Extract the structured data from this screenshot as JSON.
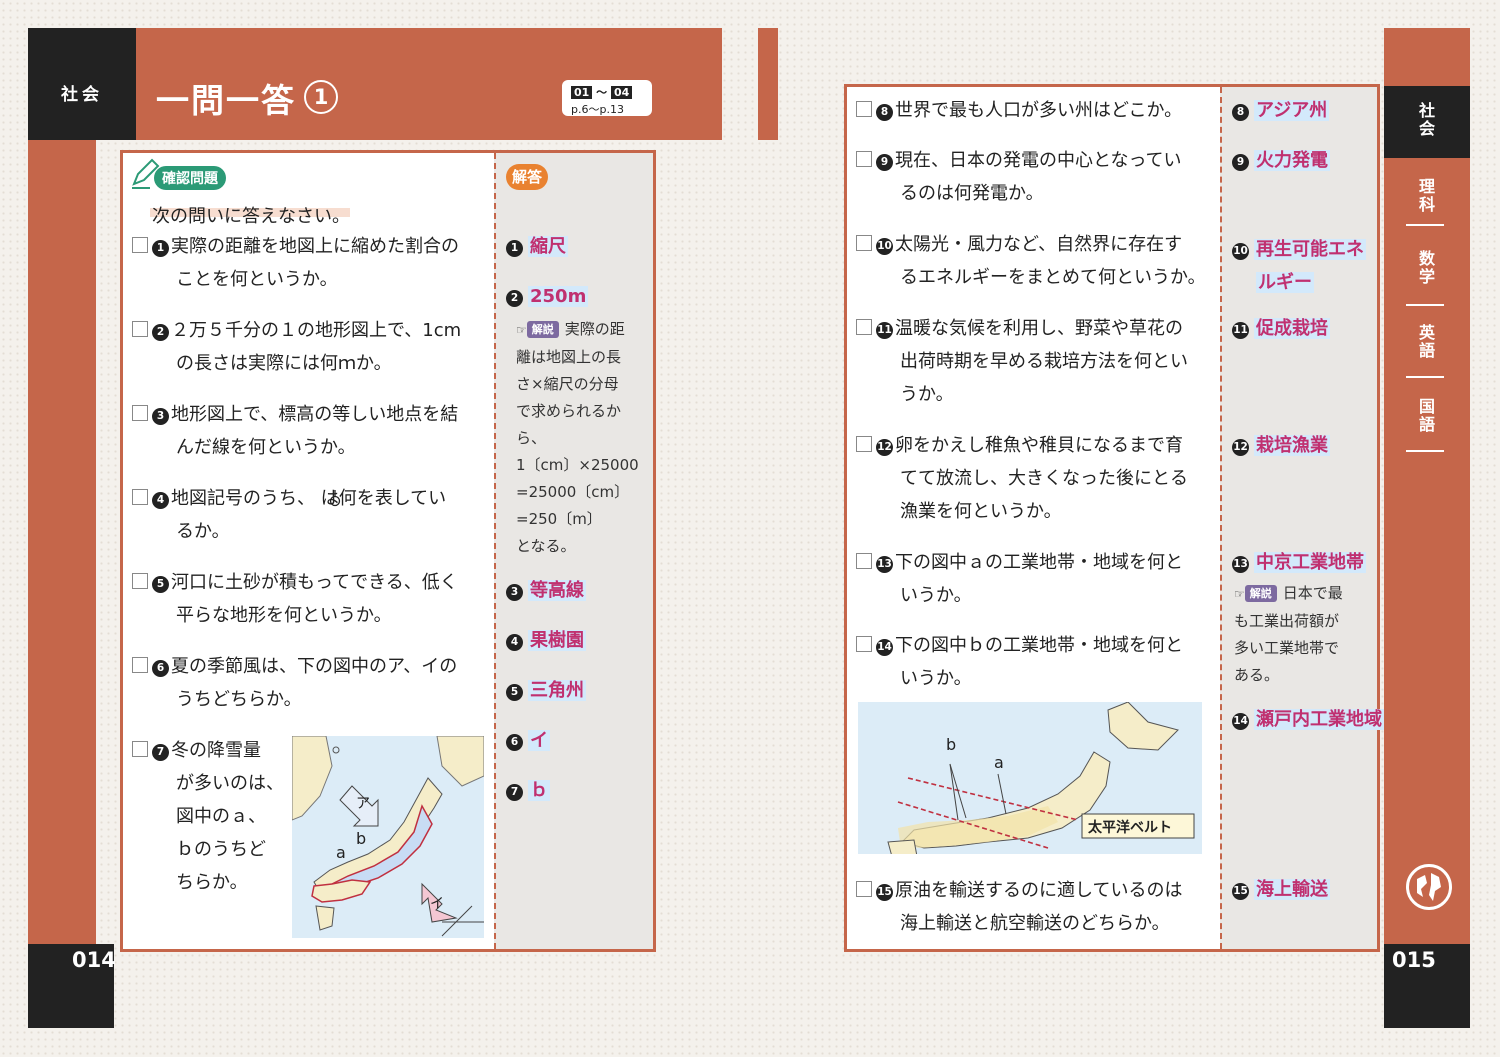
{
  "left_page": {
    "subject": "社会",
    "title": "一問一答",
    "title_number": "1",
    "range": {
      "from": "01",
      "sep": "～",
      "to": "04",
      "pages": "p.6～p.13"
    },
    "page_number": "014",
    "section_badge": "確認問題",
    "answer_badge": "解答",
    "instruction": "次の問いに答えなさい。",
    "questions": [
      {
        "n": "1",
        "lines": [
          "実際の距離を地図上に縮めた割合の",
          "ことを何というか。"
        ]
      },
      {
        "n": "2",
        "lines": [
          "２万５千分の１の地形図上で、1cm",
          "の長さは実際には何ｍか。"
        ]
      },
      {
        "n": "3",
        "lines": [
          "地形図上で、標高の等しい地点を結",
          "んだ線を何というか。"
        ]
      },
      {
        "n": "4",
        "lines": [
          "地図記号のうち、 は何を表してい",
          "るか。"
        ]
      },
      {
        "n": "5",
        "lines": [
          "河口に土砂が積もってできる、低く",
          "平らな地形を何というか。"
        ]
      },
      {
        "n": "6",
        "lines": [
          "夏の季節風は、下の図中のア、イの",
          "うちどちらか。"
        ]
      },
      {
        "n": "7",
        "lines": [
          "冬の降雪量",
          "が多いのは、",
          "図中のａ、",
          "ｂのうちど",
          "ちらか。"
        ]
      }
    ],
    "answers": [
      {
        "n": "1",
        "text": "縮尺"
      },
      {
        "n": "2",
        "text": "250m"
      },
      {
        "n": "3",
        "text": "等高線"
      },
      {
        "n": "4",
        "text": "果樹園"
      },
      {
        "n": "5",
        "text": "三角州"
      },
      {
        "n": "6",
        "text": "イ"
      },
      {
        "n": "7",
        "text": "ｂ"
      }
    ],
    "explanation": {
      "tag": "解説",
      "lines": [
        "実際の距",
        "離は地図上の長",
        "さ×縮尺の分母",
        "で求められるか",
        "ら、",
        "1〔cm〕×25000",
        "=25000〔cm〕",
        "=250〔m〕",
        "となる。"
      ]
    },
    "map_labels": {
      "a": "a",
      "b": "b",
      "ア": "ア",
      "イ": "イ"
    }
  },
  "right_page": {
    "page_number": "015",
    "side_tabs": [
      "社会",
      "理科",
      "数学",
      "英語",
      "国語"
    ],
    "questions": [
      {
        "n": "8",
        "lines": [
          "世界で最も人口が多い州はどこか。"
        ]
      },
      {
        "n": "9",
        "lines": [
          "現在、日本の発電の中心となってい",
          "るのは何発電か。"
        ]
      },
      {
        "n": "10",
        "lines": [
          "太陽光・風力など、自然界に存在す",
          "るエネルギーをまとめて何というか。"
        ]
      },
      {
        "n": "11",
        "lines": [
          "温暖な気候を利用し、野菜や草花の",
          "出荷時期を早める栽培方法を何とい",
          "うか。"
        ]
      },
      {
        "n": "12",
        "lines": [
          "卵をかえし稚魚や稚貝になるまで育",
          "てて放流し、大きくなった後にとる",
          "漁業を何というか。"
        ]
      },
      {
        "n": "13",
        "lines": [
          "下の図中ａの工業地帯・地域を何と",
          "いうか。"
        ]
      },
      {
        "n": "14",
        "lines": [
          "下の図中ｂの工業地帯・地域を何と",
          "いうか。"
        ]
      },
      {
        "n": "15",
        "lines": [
          "原油を輸送するのに適しているのは",
          "海上輸送と航空輸送のどちらか。"
        ]
      }
    ],
    "answers": [
      {
        "n": "8",
        "lines": [
          "アジア州"
        ]
      },
      {
        "n": "9",
        "lines": [
          "火力発電"
        ]
      },
      {
        "n": "10",
        "lines": [
          "再生可能エネ",
          "ルギー"
        ]
      },
      {
        "n": "11",
        "lines": [
          "促成栽培"
        ]
      },
      {
        "n": "12",
        "lines": [
          "栽培漁業"
        ]
      },
      {
        "n": "13",
        "lines": [
          "中京工業地帯"
        ]
      },
      {
        "n": "14",
        "lines": [
          "瀬戸内工業地域"
        ]
      },
      {
        "n": "15",
        "lines": [
          "海上輸送"
        ]
      }
    ],
    "explanation": {
      "tag": "解説",
      "lines": [
        "日本で最",
        "も工業出荷額が",
        "多い工業地帯で",
        "ある。"
      ]
    },
    "map_labels": {
      "a": "a",
      "b": "b",
      "belt": "太平洋ベルト"
    }
  }
}
